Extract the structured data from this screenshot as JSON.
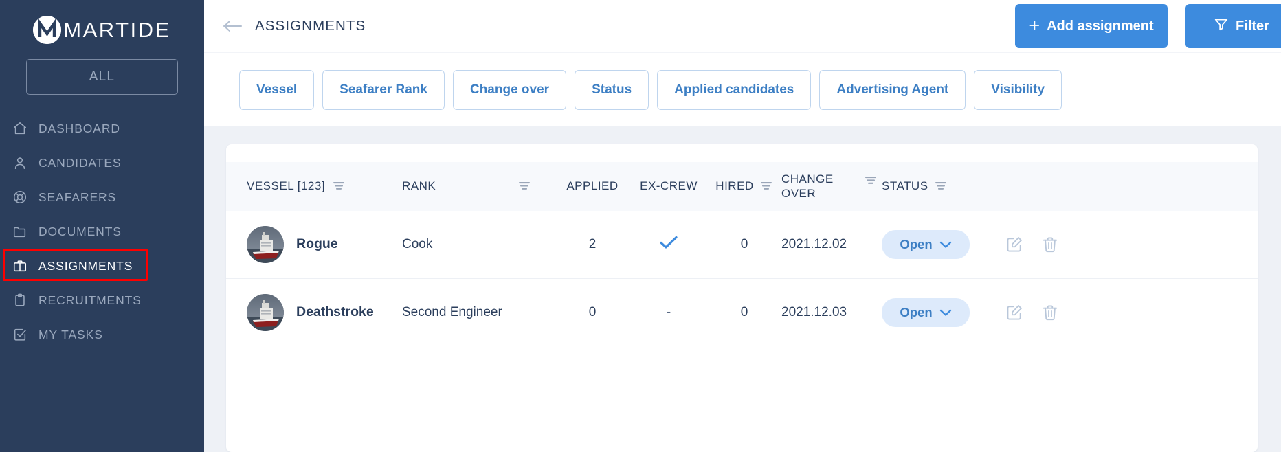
{
  "brand": {
    "name": "MARTIDE",
    "logo_icon": "martide-m-logo"
  },
  "sidebar": {
    "scope_selector": {
      "label": "ALL"
    },
    "items": [
      {
        "label": "DASHBOARD",
        "icon": "home-icon",
        "active": false
      },
      {
        "label": "CANDIDATES",
        "icon": "user-icon",
        "active": false
      },
      {
        "label": "SEAFARERS",
        "icon": "lifebuoy-icon",
        "active": false
      },
      {
        "label": "DOCUMENTS",
        "icon": "folder-icon",
        "active": false
      },
      {
        "label": "ASSIGNMENTS",
        "icon": "briefcase-icon",
        "active": true
      },
      {
        "label": "RECRUITMENTS",
        "icon": "clipboard-icon",
        "active": false
      },
      {
        "label": "MY TASKS",
        "icon": "checkbox-icon",
        "active": false
      }
    ],
    "highlight_color": "#ff0000",
    "background_color": "#2b3e5c"
  },
  "header": {
    "back_icon": "arrow-left-icon",
    "title": "ASSIGNMENTS",
    "add_button": {
      "label": "Add assignment",
      "icon": "plus-icon"
    },
    "filter_button": {
      "label": "Filter",
      "icon": "funnel-icon"
    },
    "accent_color": "#3d8bde"
  },
  "filter_pills": [
    {
      "label": "Vessel"
    },
    {
      "label": "Seafarer Rank"
    },
    {
      "label": "Change over"
    },
    {
      "label": "Status"
    },
    {
      "label": "Applied candidates"
    },
    {
      "label": "Advertising Agent"
    },
    {
      "label": "Visibility"
    }
  ],
  "table": {
    "columns": [
      {
        "label": "VESSEL [123]",
        "sortable": true,
        "sort_icon": "sort-icon"
      },
      {
        "label": "RANK",
        "sortable": true,
        "sort_icon": "sort-icon"
      },
      {
        "label": "APPLIED",
        "sortable": false
      },
      {
        "label": "EX-CREW",
        "sortable": false
      },
      {
        "label": "HIRED",
        "sortable": true,
        "sort_icon": "sort-icon"
      },
      {
        "label": "CHANGE OVER",
        "sortable": true,
        "sort_icon": "sort-icon"
      },
      {
        "label": "STATUS",
        "sortable": true,
        "sort_icon": "sort-icon"
      }
    ],
    "rows": [
      {
        "vessel": "Rogue",
        "avatar_icon": "vessel-photo",
        "rank": "Cook",
        "applied": "2",
        "ex_crew": "check",
        "hired": "0",
        "change_over": "2021.12.02",
        "status": "Open",
        "edit_icon": "edit-icon",
        "delete_icon": "trash-icon"
      },
      {
        "vessel": "Deathstroke",
        "avatar_icon": "vessel-photo",
        "rank": "Second Engineer",
        "applied": "0",
        "ex_crew": "-",
        "hired": "0",
        "change_over": "2021.12.03",
        "status": "Open",
        "edit_icon": "edit-icon",
        "delete_icon": "trash-icon"
      }
    ],
    "status_chevron_icon": "chevron-down-icon"
  }
}
